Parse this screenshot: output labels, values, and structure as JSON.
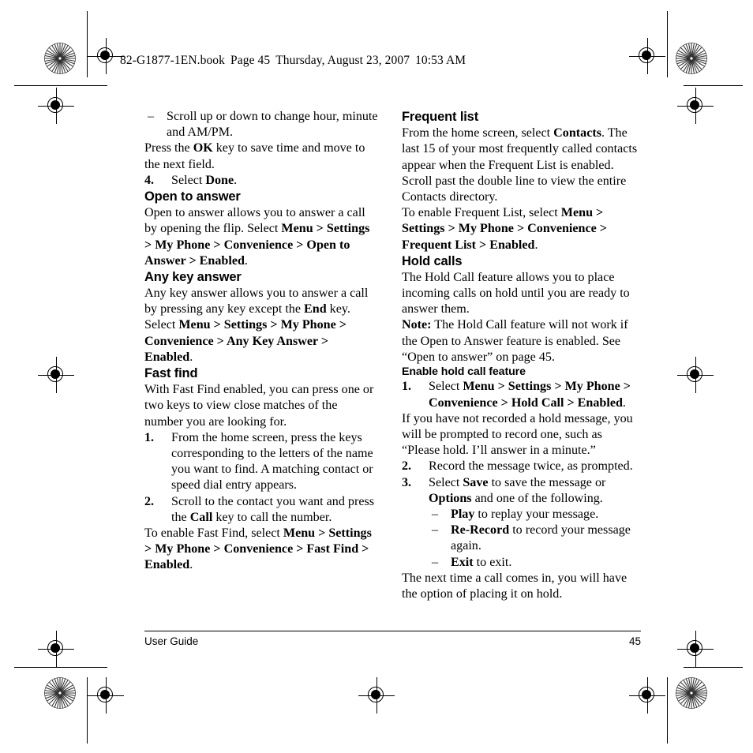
{
  "book_header": {
    "filename": "82-G1877-1EN.book",
    "page_label": "Page 45",
    "date": "Thursday, August 23, 2007",
    "time": "10:53 AM"
  },
  "left_column": {
    "cont_bullet": {
      "dash": "–",
      "text": "Scroll up or down to change hour, minute and AM/PM."
    },
    "cont_paragraph": {
      "before": "Press the ",
      "bold": "OK",
      "after": " key to save time and move to the next field."
    },
    "step4": {
      "num": "4.",
      "before": "Select ",
      "bold": "Done",
      "after": "."
    },
    "open_to_answer": {
      "heading": "Open to answer",
      "intro": "Open to answer allows you to answer a call by opening the flip. Select ",
      "path": "Menu > Settings > My Phone > Convenience > Open to Answer > Enabled",
      "period": "."
    },
    "any_key_answer": {
      "heading": "Any key answer",
      "intro_a": "Any key answer allows you to answer a call by pressing any key except the ",
      "intro_bold": "End",
      "intro_b": " key. Select ",
      "path": "Menu > Settings > My Phone > Convenience > Any Key Answer > Enabled",
      "period": "."
    },
    "fast_find": {
      "heading": "Fast find",
      "intro": "With Fast Find enabled, you can press one or two keys to view close matches of the number you are looking for.",
      "steps": [
        {
          "num": "1.",
          "text": "From the home screen, press the keys corresponding to the letters of the name you want to find. A matching contact or speed dial entry appears."
        },
        {
          "num": "2.",
          "before": "Scroll to the contact you want and press the ",
          "bold": "Call",
          "after": " key to call the number."
        }
      ],
      "enable_before": "To enable Fast Find, select ",
      "enable_path": "Menu > Settings > My Phone > Convenience > Fast Find > Enabled",
      "enable_period": "."
    }
  },
  "right_column": {
    "frequent_list": {
      "heading": "Frequent list",
      "body_a": "From the home screen, select ",
      "body_bold": "Contacts",
      "body_b": ". The last 15 of your most frequently called contacts appear when the Frequent List is enabled. Scroll past the double line to view the entire Contacts directory.",
      "enable_before": "To enable Frequent List, select ",
      "enable_path": "Menu > Settings > My Phone > Convenience > Frequent List > Enabled",
      "enable_period": "."
    },
    "hold_calls": {
      "heading": "Hold calls",
      "intro": "The Hold Call feature allows you to place incoming calls on hold until you are ready to answer them.",
      "note_label": "Note:",
      "note_text": " The Hold Call feature will not work if the Open to Answer feature is enabled. See “Open to answer” on page 45."
    },
    "enable_hold": {
      "heading": "Enable hold call feature",
      "step1": {
        "num": "1.",
        "before": "Select ",
        "path": "Menu > Settings > My Phone > Convenience > Hold Call > Enabled",
        "period": ".",
        "followup": "If you have not recorded a hold message, you will be prompted to record one, such as “Please hold. I’ll answer in a minute.”"
      },
      "step2": {
        "num": "2.",
        "text": "Record the message twice, as prompted."
      },
      "step3": {
        "num": "3.",
        "before": "Select ",
        "bold_save": "Save",
        "middle": " to save the message or ",
        "bold_options": "Options",
        "after": " and one of the following.",
        "options": [
          {
            "dash": "–",
            "bold": "Play",
            "text": " to replay your message."
          },
          {
            "dash": "–",
            "bold": "Re-Record",
            "text": " to record your message again."
          },
          {
            "dash": "–",
            "bold": "Exit",
            "text": " to exit."
          }
        ]
      },
      "closing": "The next time a call comes in, you will have the option of placing it on hold."
    }
  },
  "footer": {
    "left_label": "User Guide",
    "page_number": "45"
  }
}
